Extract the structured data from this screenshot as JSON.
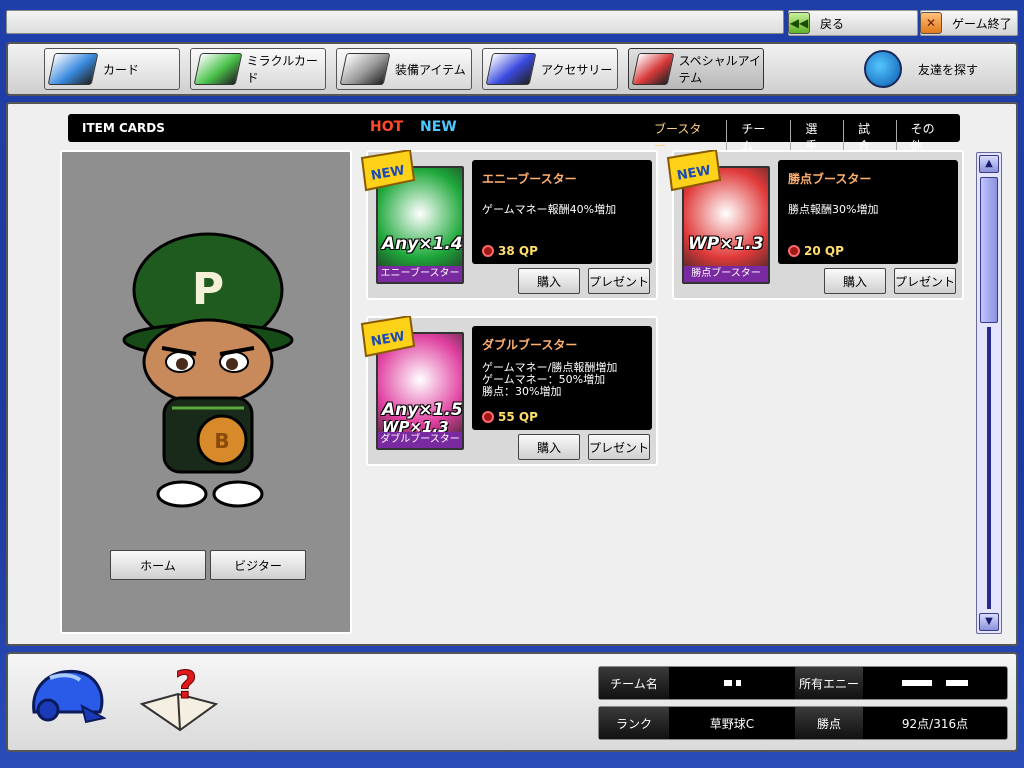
{
  "topbar": {
    "back_label": "戻る",
    "exit_label": "ゲーム終了"
  },
  "categories": [
    {
      "label": "カード",
      "color": "#3a8adf"
    },
    {
      "label": "ミラクルカード",
      "color": "#4ac24a"
    },
    {
      "label": "装備アイテム",
      "color": "#999999"
    },
    {
      "label": "アクセサリー",
      "color": "#3a4adf"
    },
    {
      "label": "スペシャルアイテム",
      "color": "#d83a3a"
    }
  ],
  "friend_label": "友達を探す",
  "header": {
    "label": "ITEM CARDS",
    "hot": "HOT",
    "new": "NEW",
    "filters": [
      "ブースター",
      "チーム",
      "選手",
      "試合",
      "その他"
    ]
  },
  "preview": {
    "home_label": "ホーム",
    "visitor_label": "ビジター",
    "cap_letter": "P"
  },
  "items": [
    {
      "badge": "NEW",
      "name": "エニーブースター",
      "desc": "ゲームマネー報酬40%増加",
      "price": "38 QP",
      "caption": "エニーブースター",
      "big1": "Any×1.4",
      "big2": "",
      "bg": "#1ea83a",
      "buy": "購入",
      "gift": "プレゼント"
    },
    {
      "badge": "NEW",
      "name": "勝点ブースター",
      "desc": "勝点報酬30%増加",
      "price": "20 QP",
      "caption": "勝点ブースター",
      "big1": "WP×1.3",
      "big2": "",
      "bg": "#e03a3a",
      "buy": "購入",
      "gift": "プレゼント"
    },
    {
      "badge": "NEW",
      "name": "ダブルブースター",
      "desc": "ゲームマネー/勝点報酬増加\nゲームマネー：50%増加\n勝点：30%増加",
      "price": "55 QP",
      "caption": "ダブルブースター",
      "big1": "Any×1.5",
      "big2": "WP×1.3",
      "bg": "#e040a0",
      "buy": "購入",
      "gift": "プレゼント"
    }
  ],
  "stats": {
    "team_label": "チーム名",
    "money_label": "所有エニー",
    "rank_label": "ランク",
    "rank_value": "草野球C",
    "points_label": "勝点",
    "points_value": "92点/316点"
  }
}
